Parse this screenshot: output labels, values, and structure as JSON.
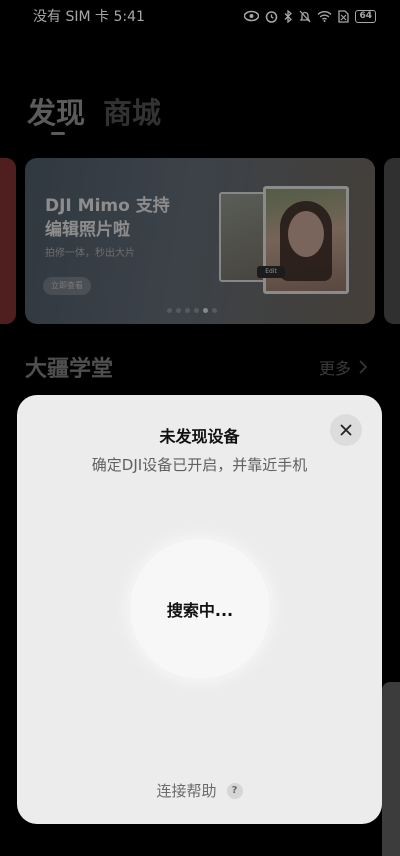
{
  "status_bar": {
    "carrier_time": "没有 SIM 卡 5:41",
    "battery": "64",
    "icons": [
      "eye-icon",
      "alarm-icon",
      "bluetooth-icon",
      "bell-off-icon",
      "wifi-icon",
      "sim-off-icon",
      "battery-icon"
    ]
  },
  "background": {
    "tabs": [
      {
        "label": "发现",
        "active": true
      },
      {
        "label": "商城",
        "active": false
      }
    ],
    "banner": {
      "title": "DJI Mimo 支持\n编辑照片啦",
      "subtitle": "拍修一体，秒出大片",
      "button_label": "立即查看",
      "edit_tag": "Edit",
      "page_count": 6,
      "active_index": 4
    },
    "section": {
      "title": "大疆学堂",
      "more_label": "更多"
    }
  },
  "dialog": {
    "title": "未发现设备",
    "subtitle": "确定DJI设备已开启，并靠近手机",
    "searching_label": "搜索中...",
    "help_label": "连接帮助",
    "help_icon_glyph": "?"
  },
  "colors": {
    "dialog_bg": "#ececec",
    "page_bg": "#000000"
  }
}
